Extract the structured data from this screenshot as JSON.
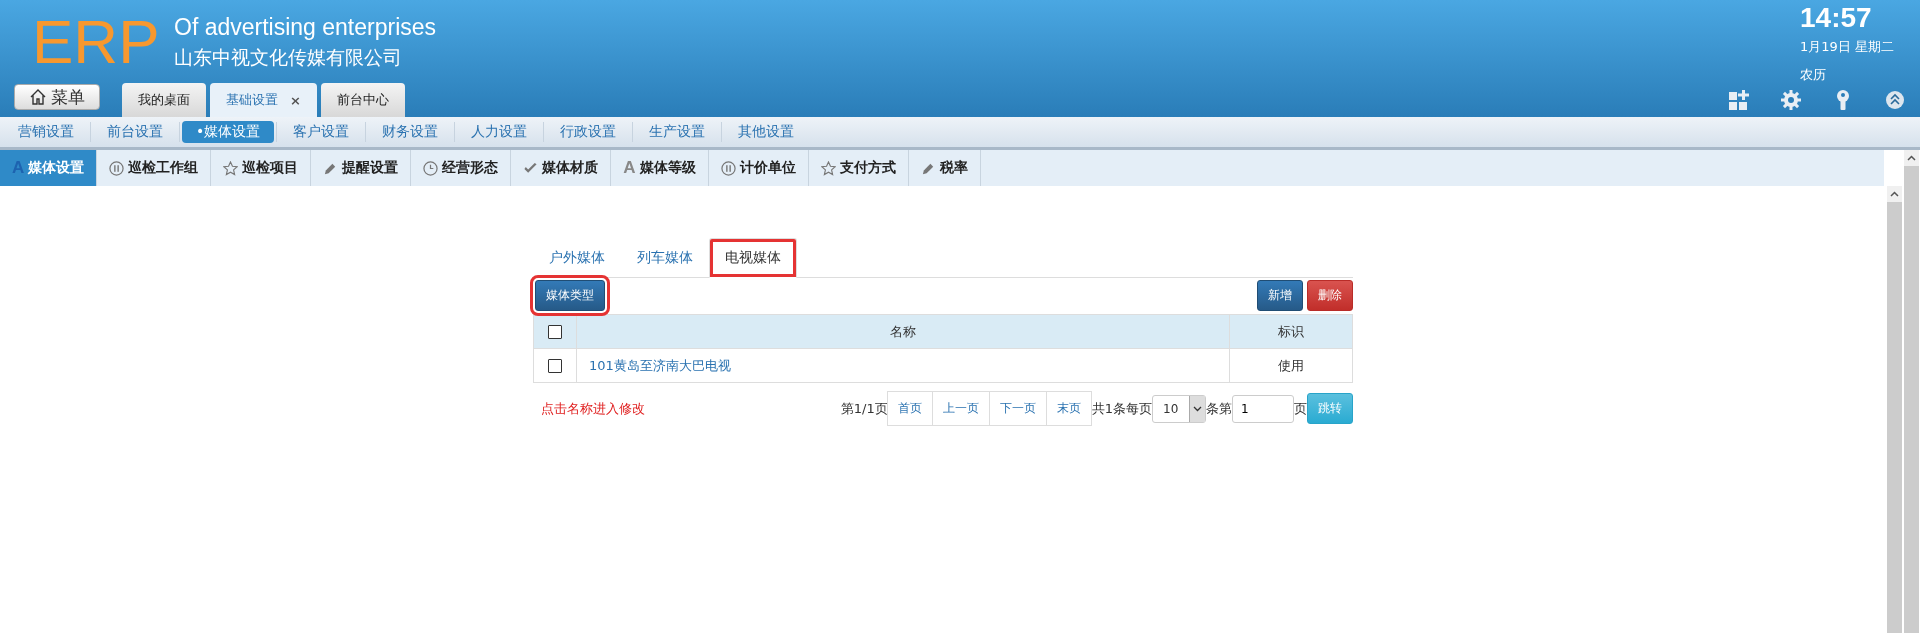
{
  "header": {
    "logo": "ERP",
    "subtitle": "Of advertising enterprises",
    "company": "山东中视文化传媒有限公司",
    "menu_button": "菜单",
    "time": "14:57",
    "date": "1月19日 星期二",
    "lunar": "农历"
  },
  "top_tabs": [
    {
      "label": "我的桌面",
      "selected": false
    },
    {
      "label": "基础设置",
      "selected": true,
      "close": "×"
    },
    {
      "label": "前台中心",
      "selected": false
    }
  ],
  "nav": [
    {
      "label": "营销设置",
      "selected": false
    },
    {
      "label": "前台设置",
      "selected": false
    },
    {
      "label": "•媒体设置",
      "selected": true
    },
    {
      "label": "客户设置",
      "selected": false
    },
    {
      "label": "财务设置",
      "selected": false
    },
    {
      "label": "人力设置",
      "selected": false
    },
    {
      "label": "行政设置",
      "selected": false
    },
    {
      "label": "生产设置",
      "selected": false
    },
    {
      "label": "其他设置",
      "selected": false
    }
  ],
  "sub_nav": [
    {
      "label": "媒体设置",
      "kind": "letter",
      "glyph": "A",
      "selected": true
    },
    {
      "label": "巡检工作组",
      "kind": "pause",
      "selected": false
    },
    {
      "label": "巡检项目",
      "kind": "star",
      "selected": false
    },
    {
      "label": "提醒设置",
      "kind": "pencil",
      "selected": false
    },
    {
      "label": "经营形态",
      "kind": "clock",
      "selected": false
    },
    {
      "label": "媒体材质",
      "kind": "check",
      "selected": false
    },
    {
      "label": "媒体等级",
      "kind": "letter",
      "glyph": "A",
      "selected": false
    },
    {
      "label": "计价单位",
      "kind": "pause",
      "selected": false
    },
    {
      "label": "支付方式",
      "kind": "star",
      "selected": false
    },
    {
      "label": "税率",
      "kind": "pencil",
      "selected": false
    }
  ],
  "media_tabs": [
    {
      "label": "户外媒体",
      "selected": false,
      "highlighted": false
    },
    {
      "label": "列车媒体",
      "selected": false,
      "highlighted": false
    },
    {
      "label": "电视媒体",
      "selected": true,
      "highlighted": true
    }
  ],
  "toolbar": {
    "type_button": {
      "label": "媒体类型",
      "highlighted": true
    },
    "add_button": "新增",
    "delete_button": "删除"
  },
  "table": {
    "header_checked": false,
    "columns": [
      "名称",
      "标识"
    ],
    "rows": [
      {
        "checked": false,
        "name": "101黄岛至济南大巴电视",
        "flag": "使用"
      }
    ]
  },
  "hint": "点击名称进入修改",
  "pager": {
    "page_info": "第1/1页",
    "buttons": [
      "首页",
      "上一页",
      "下一页",
      "末页"
    ],
    "total": "共1条每页",
    "page_size": "10",
    "row_label": "条第",
    "page_input": "1",
    "page_label": "页",
    "go_button": "跳转"
  }
}
